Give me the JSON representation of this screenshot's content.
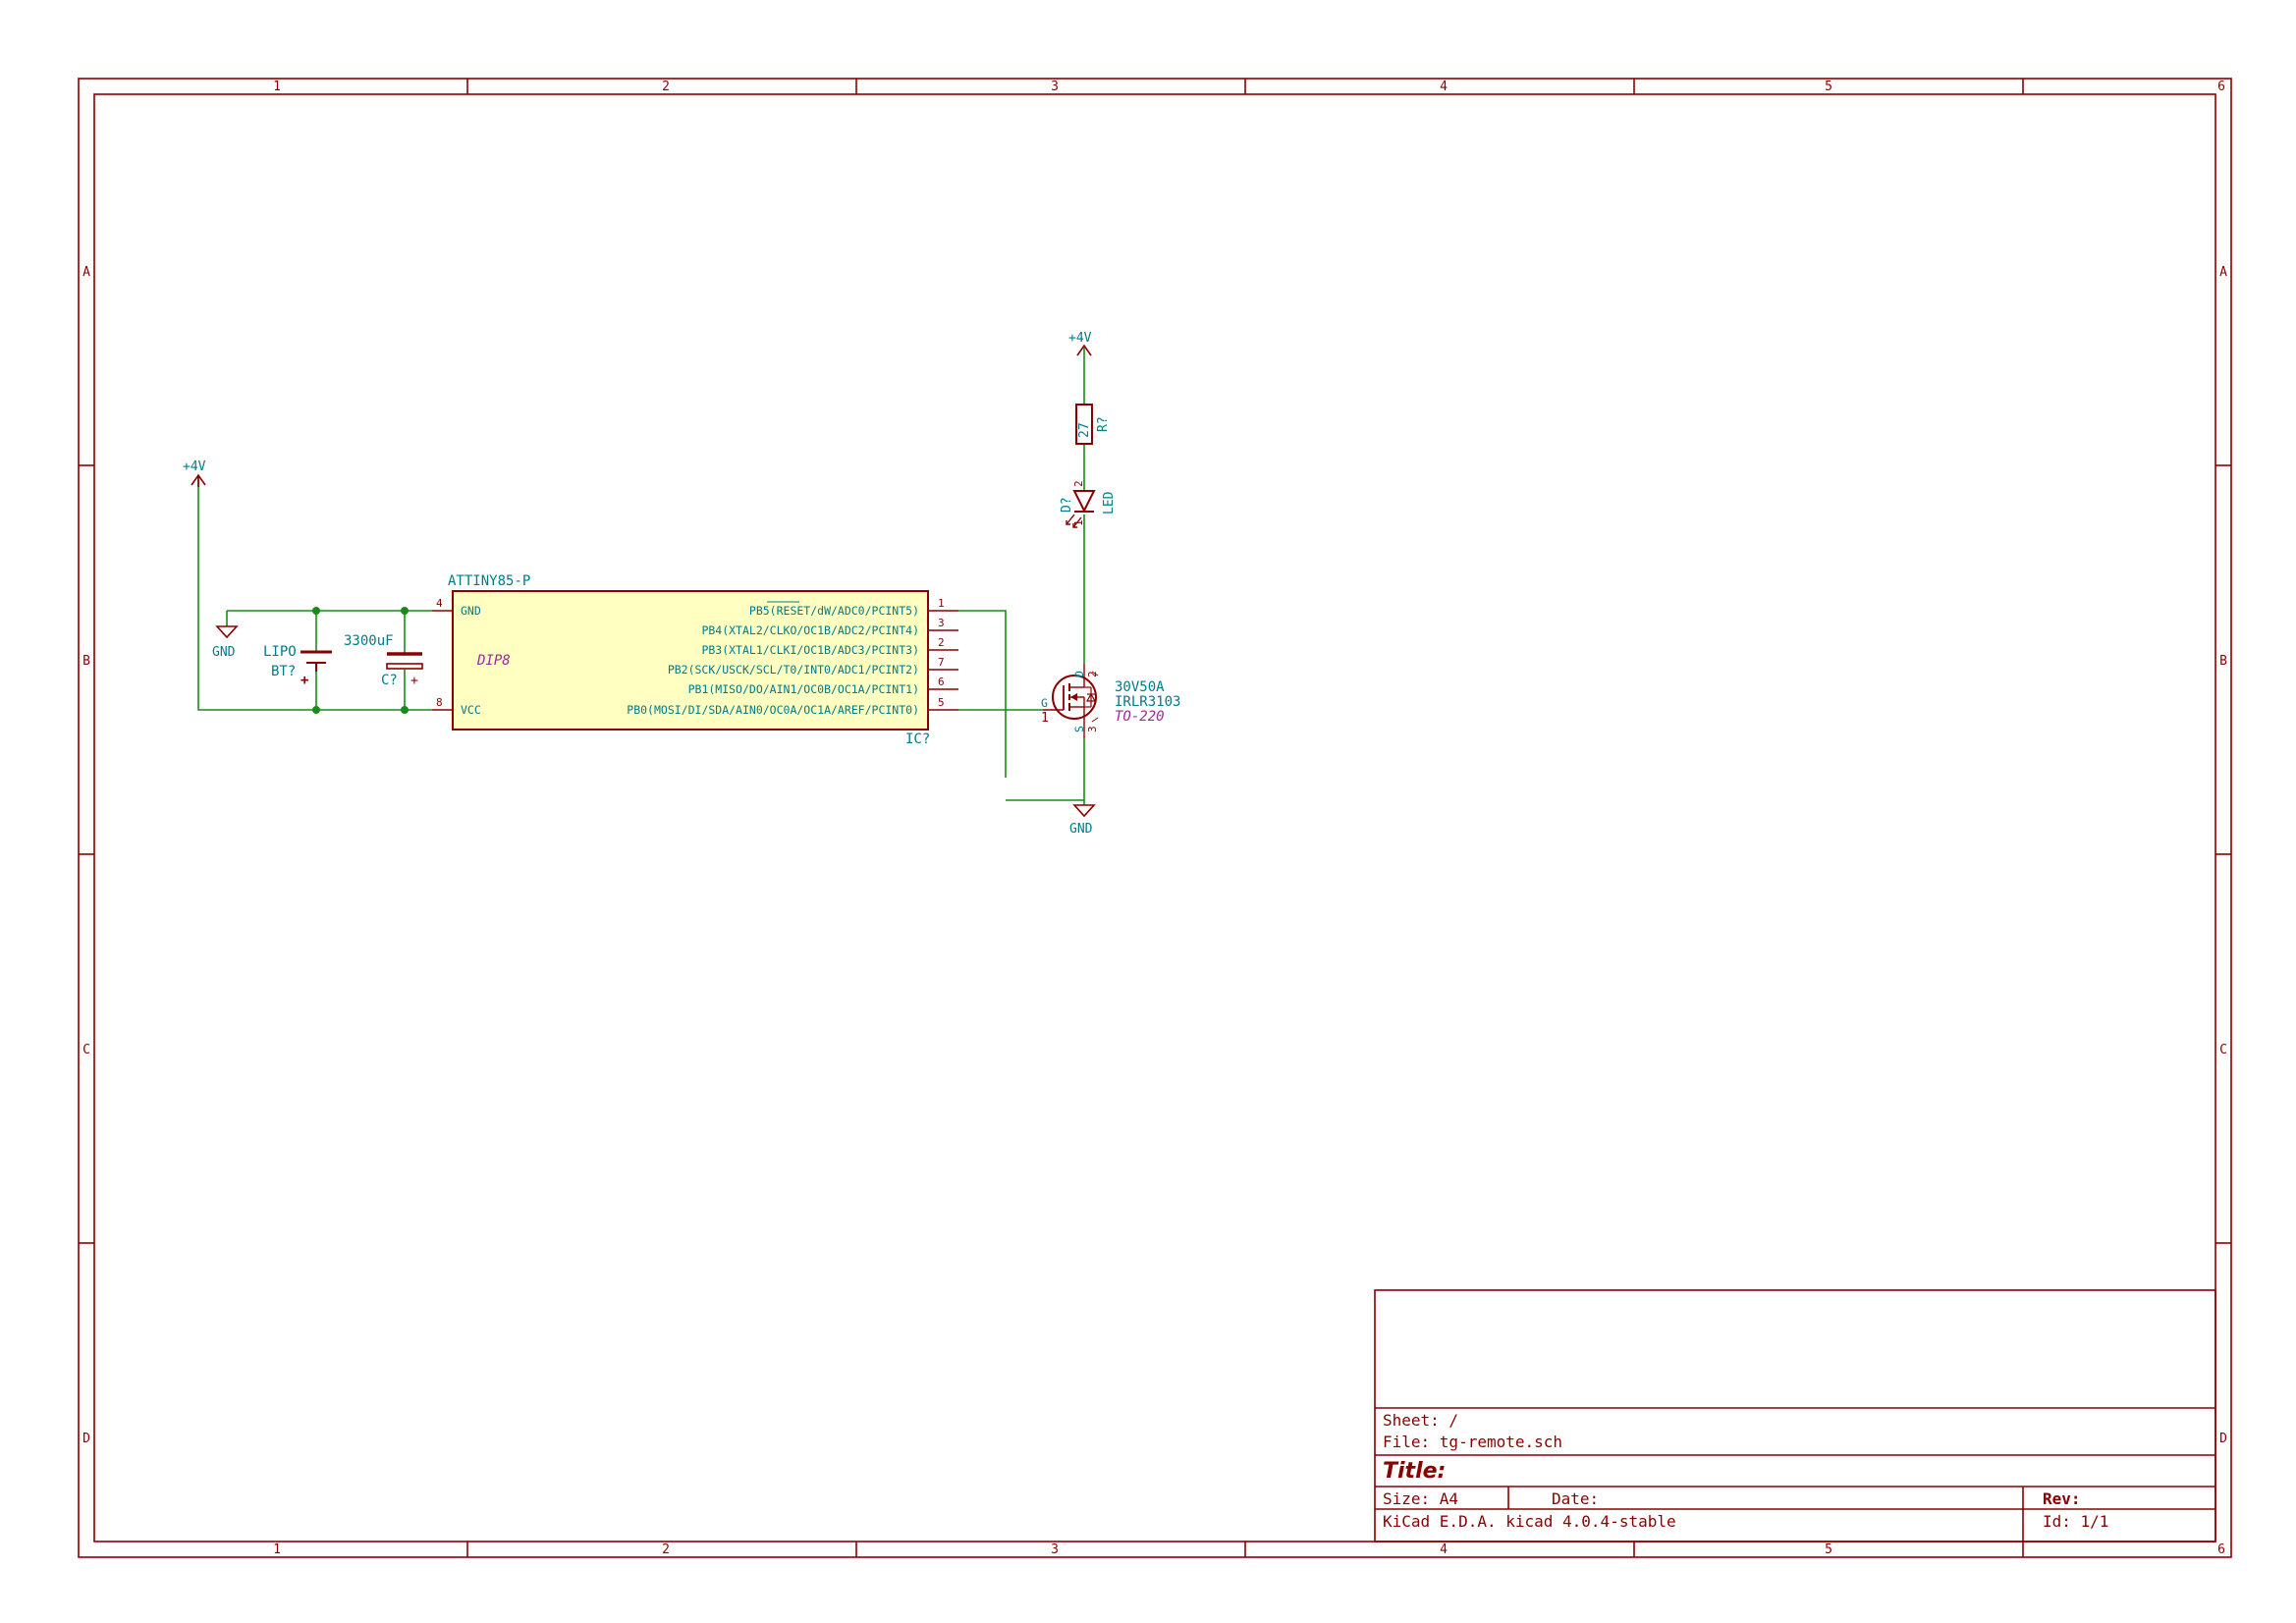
{
  "frame": {
    "columns": [
      "1",
      "2",
      "3",
      "4",
      "5",
      "6"
    ],
    "rows": [
      "A",
      "B",
      "C",
      "D"
    ]
  },
  "power": {
    "left_rail": "+4V",
    "led_rail": "+4V",
    "gnd_left": "GND",
    "gnd_right": "GND"
  },
  "battery": {
    "value": "LIPO",
    "ref": "BT?"
  },
  "capacitor": {
    "value": "3300uF",
    "ref": "C?",
    "polarity": "+"
  },
  "ic": {
    "part": "ATTINY85-P",
    "ref": "IC?",
    "footprint": "DIP8",
    "left_pins": [
      {
        "num": "4",
        "name": "GND"
      },
      {
        "num": "8",
        "name": "VCC"
      }
    ],
    "right_pins": [
      {
        "num": "1",
        "name": "PB5(RESET/dW/ADC0/PCINT5)"
      },
      {
        "num": "3",
        "name": "PB4(XTAL2/CLKO/OC1B/ADC2/PCINT4)"
      },
      {
        "num": "2",
        "name": "PB3(XTAL1/CLKI/OC1B/ADC3/PCINT3)"
      },
      {
        "num": "7",
        "name": "PB2(SCK/USCK/SCL/T0/INT0/ADC1/PCINT2)"
      },
      {
        "num": "6",
        "name": "PB1(MISO/DO/AIN1/OC0B/OC1A/PCINT1)"
      },
      {
        "num": "5",
        "name": "PB0(MOSI/DI/SDA/AIN0/OC0A/OC1A/AREF/PCINT0)"
      }
    ]
  },
  "resistor": {
    "value": "27",
    "ref": "R?"
  },
  "led": {
    "ref": "D?",
    "value": "LED",
    "pin_a": "2",
    "pin_k": "1"
  },
  "mosfet": {
    "value": "30V50A",
    "part": "IRLR3103",
    "footprint": "TO-220",
    "pin_g": "G",
    "pin_d": "D",
    "pin_s": "S",
    "pin_g_num": "1",
    "pin_d_num": "2",
    "pin_s_num": "3"
  },
  "title_block": {
    "sheet": "Sheet: /",
    "file": "File: tg-remote.sch",
    "title": "Title:",
    "size": "Size: A4",
    "date": "Date:",
    "rev": "Rev:",
    "tool": "KiCad E.D.A.  kicad 4.0.4-stable",
    "id": "Id: 1/1"
  },
  "colors": {
    "frame": "#8a0000",
    "wire": "#1a8a1a",
    "label": "#007b8a",
    "ic_fill": "#ffffc2",
    "footprint": "#9b2a9b"
  }
}
